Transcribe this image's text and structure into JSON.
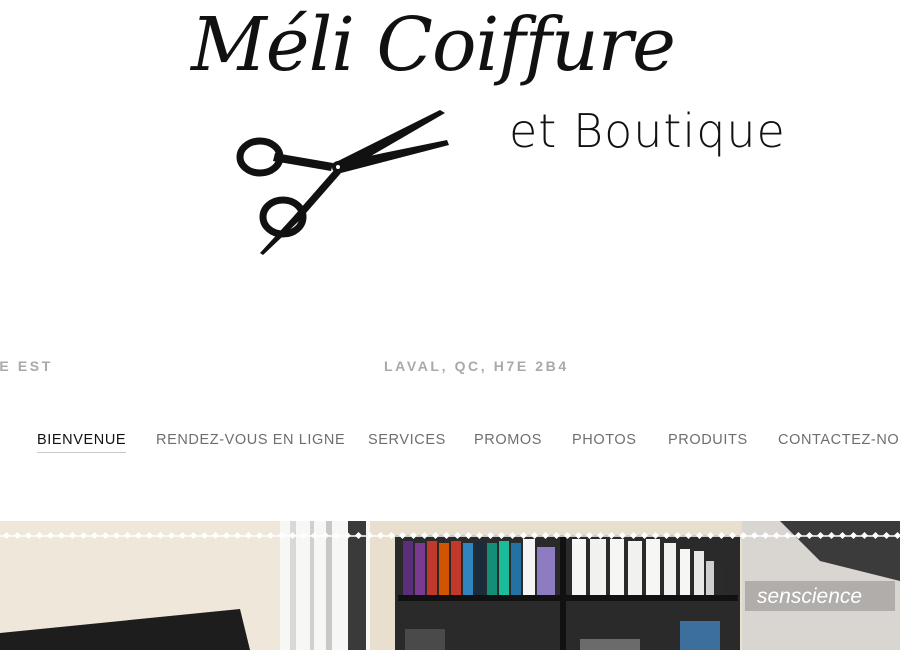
{
  "logo": {
    "title": "Méli Coiffure",
    "subtitle": "et Boutique",
    "icon": "scissors-icon"
  },
  "address": {
    "street": "RDE EST",
    "city": "LAVAL, QC, H7E 2B4"
  },
  "nav": {
    "items": [
      {
        "label": "BIENVENUE",
        "active": true
      },
      {
        "label": "RENDEZ-VOUS EN LIGNE",
        "active": false
      },
      {
        "label": "SERVICES",
        "active": false
      },
      {
        "label": "PROMOS",
        "active": false
      },
      {
        "label": "PHOTOS",
        "active": false
      },
      {
        "label": "PRODUITS",
        "active": false
      },
      {
        "label": "CONTACTEZ-NOU",
        "active": false
      }
    ]
  },
  "hero": {
    "brand_sign": "senscience",
    "colors": {
      "wall": "#e9dfcf",
      "shelf": "#1b1b1b",
      "sign_bg": "#d9d6d2"
    }
  }
}
